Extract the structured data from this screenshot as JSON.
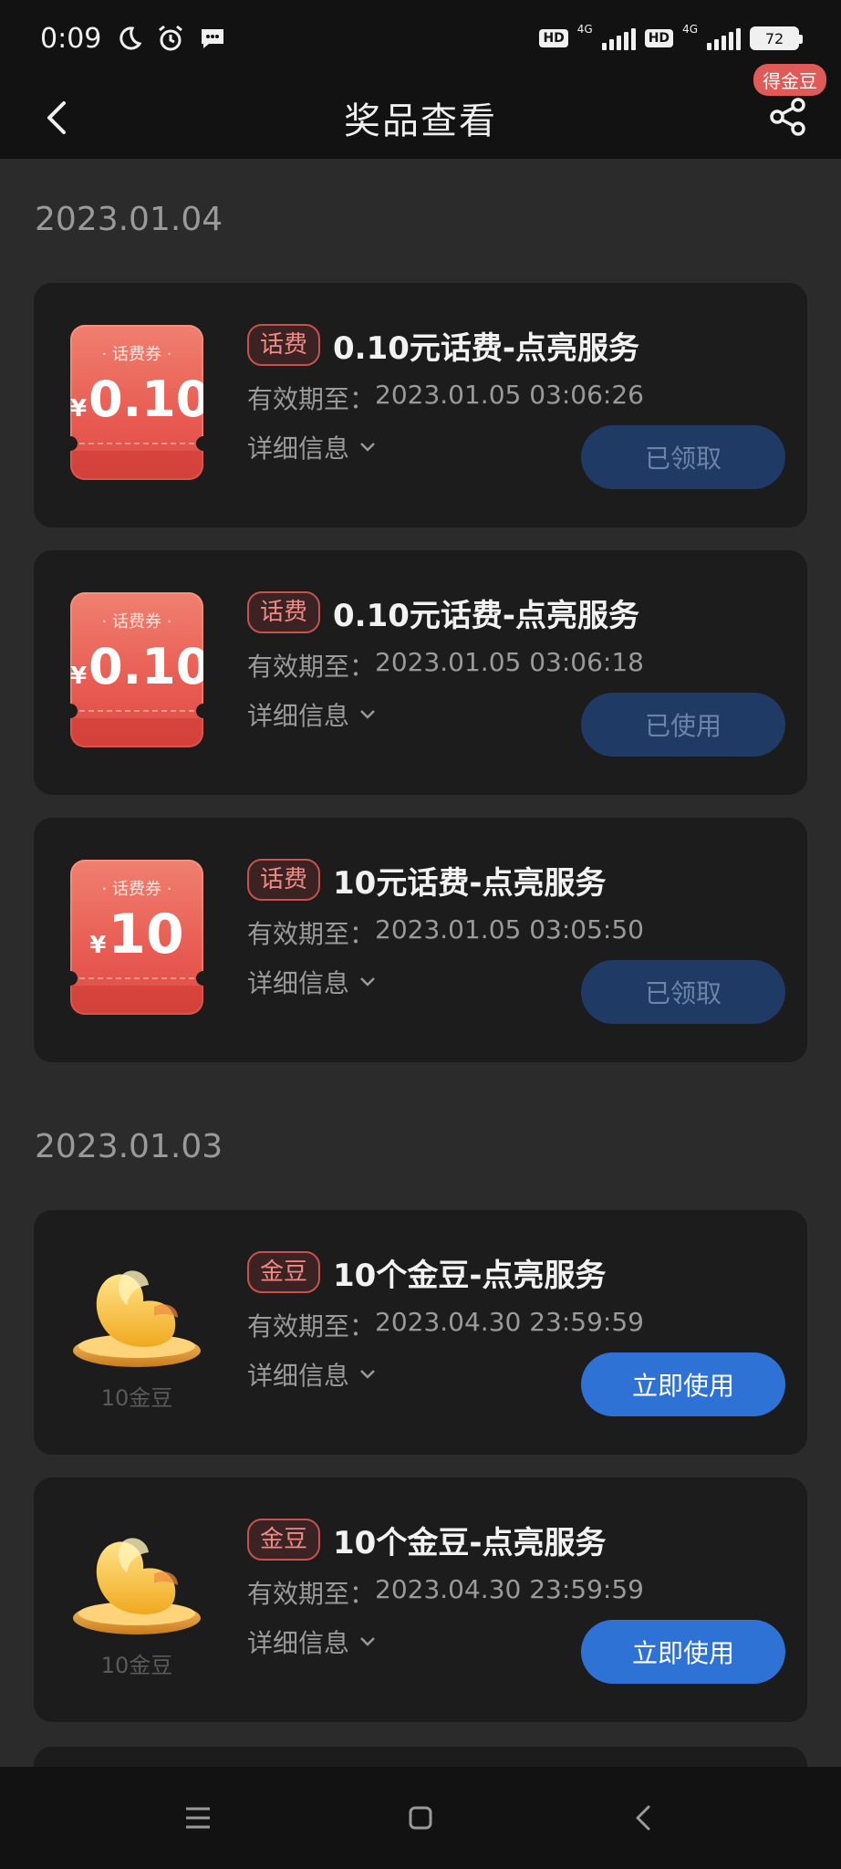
{
  "status_bar": {
    "time": "0:09",
    "icons": [
      "moon-icon",
      "alarm-icon",
      "message-icon"
    ],
    "hd1": "HD",
    "net1": "4G",
    "hd2": "HD",
    "net2": "4G",
    "battery": "72"
  },
  "header": {
    "title": "奖品查看",
    "share_badge": "得金豆"
  },
  "groups": [
    {
      "date": "2023.01.04",
      "items": [
        {
          "thumb_type": "ticket",
          "ticket_label": "· 话费券 ·",
          "ticket_yen": "¥",
          "ticket_amount": "0.10",
          "tag": "话费",
          "name": "0.10元话费-点亮服务",
          "validity_label": "有效期至：",
          "validity_value": "2023.01.05 03:06:26",
          "details": "详细信息",
          "action": "已领取",
          "action_state": "done"
        },
        {
          "thumb_type": "ticket",
          "ticket_label": "· 话费券 ·",
          "ticket_yen": "¥",
          "ticket_amount": "0.10",
          "tag": "话费",
          "name": "0.10元话费-点亮服务",
          "validity_label": "有效期至：",
          "validity_value": "2023.01.05 03:06:18",
          "details": "详细信息",
          "action": "已使用",
          "action_state": "done"
        },
        {
          "thumb_type": "ticket",
          "ticket_label": "· 话费券 ·",
          "ticket_yen": "¥",
          "ticket_amount": "10",
          "tag": "话费",
          "name": "10元话费-点亮服务",
          "validity_label": "有效期至：",
          "validity_value": "2023.01.05 03:05:50",
          "details": "详细信息",
          "action": "已领取",
          "action_state": "done"
        }
      ]
    },
    {
      "date": "2023.01.03",
      "items": [
        {
          "thumb_type": "beans",
          "bean_caption": "10金豆",
          "tag": "金豆",
          "name": "10个金豆-点亮服务",
          "validity_label": "有效期至：",
          "validity_value": "2023.04.30 23:59:59",
          "details": "详细信息",
          "action": "立即使用",
          "action_state": "active"
        },
        {
          "thumb_type": "beans",
          "bean_caption": "10金豆",
          "tag": "金豆",
          "name": "10个金豆-点亮服务",
          "validity_label": "有效期至：",
          "validity_value": "2023.04.30 23:59:59",
          "details": "详细信息",
          "action": "立即使用",
          "action_state": "active"
        }
      ]
    }
  ],
  "colors": {
    "background": "#2b2b2b",
    "card": "#1c1c1c",
    "accent_blue": "#2f72d6",
    "tag_red": "#c7524d"
  },
  "nav_icons": [
    "menu-icon",
    "home-square-icon",
    "back-triangle-icon"
  ]
}
